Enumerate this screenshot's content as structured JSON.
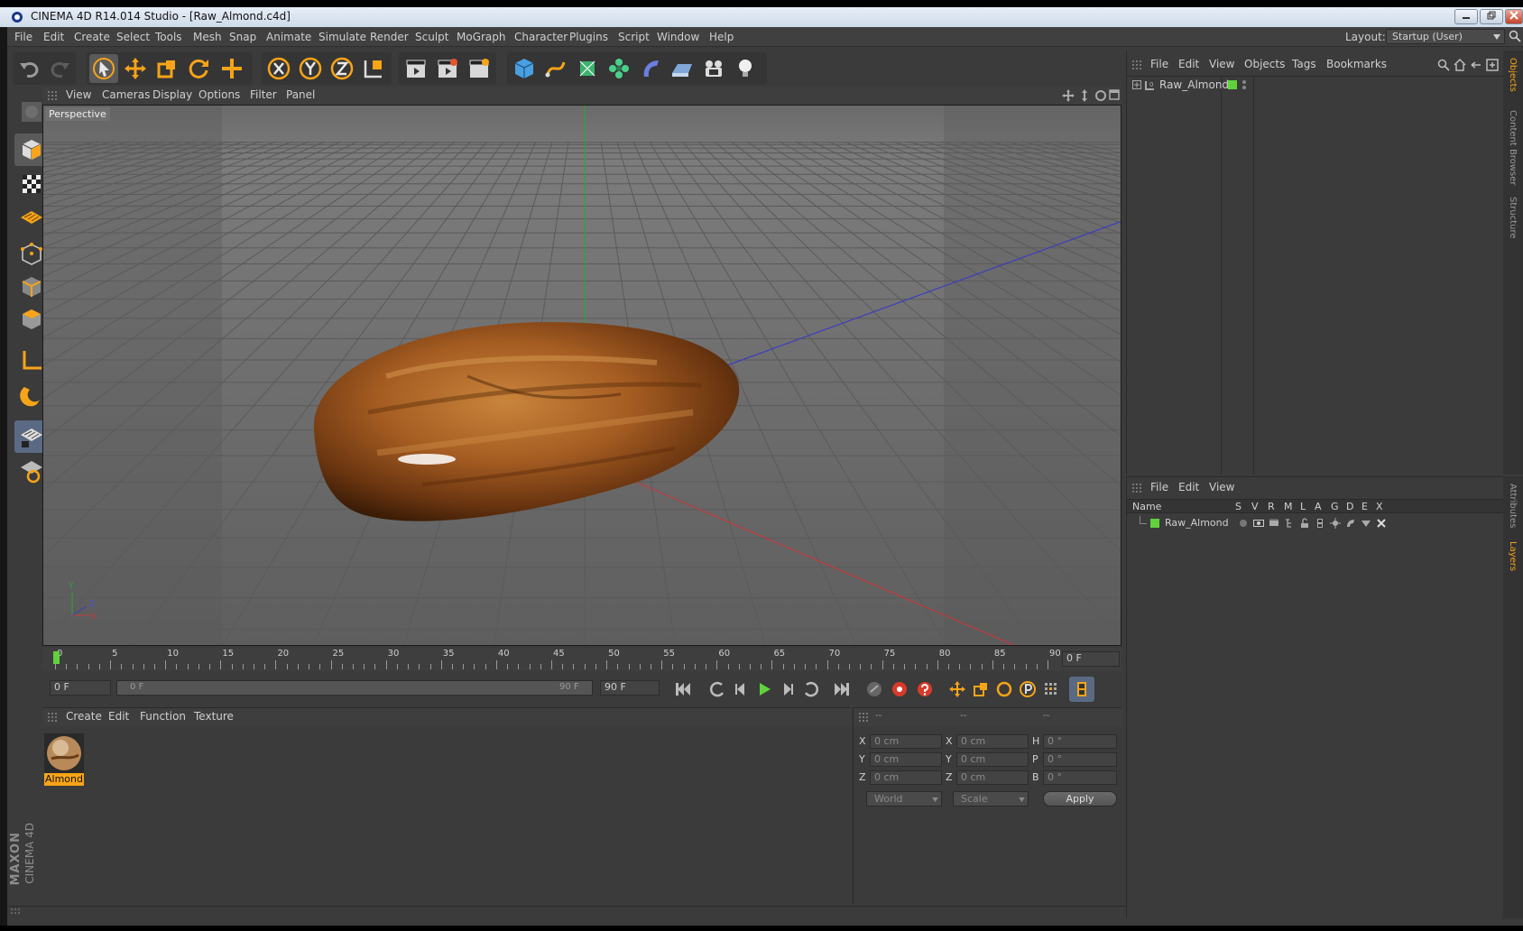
{
  "app": {
    "title": "CINEMA 4D R14.014 Studio - [Raw_Almond.c4d]",
    "window_controls": [
      "minimize-icon",
      "restore-icon",
      "close-icon"
    ]
  },
  "menubar": {
    "items": [
      "File",
      "Edit",
      "Create",
      "Select",
      "Tools",
      "Mesh",
      "Snap",
      "Animate",
      "Simulate",
      "Render",
      "Sculpt",
      "MoGraph",
      "Character",
      "Plugins",
      "Script",
      "Window",
      "Help"
    ],
    "layout_label": "Layout:",
    "layout_value": "Startup (User)"
  },
  "viewport": {
    "menu": [
      "View",
      "Cameras",
      "Display",
      "Options",
      "Filter",
      "Panel"
    ],
    "label": "Perspective",
    "axis_labels": {
      "y": "Y",
      "x": "X",
      "z": "Z"
    }
  },
  "timeline": {
    "ticks": [
      "0",
      "5",
      "10",
      "15",
      "20",
      "25",
      "30",
      "35",
      "40",
      "45",
      "50",
      "55",
      "60",
      "65",
      "70",
      "75",
      "80",
      "85",
      "90"
    ],
    "current_frame": "0 F",
    "start_field": "0 F",
    "range_start": "0 F",
    "range_end": "90 F",
    "end_field": "90 F",
    "playhead_fraction": 0.0
  },
  "material_manager": {
    "menu": [
      "Create",
      "Edit",
      "Function",
      "Texture"
    ],
    "materials": [
      {
        "name": "Almond"
      }
    ]
  },
  "coordinates": {
    "headers": [
      "--",
      "--",
      "--"
    ],
    "rows": [
      {
        "a_label": "X",
        "a_value": "0 cm",
        "b_label": "X",
        "b_value": "0 cm",
        "c_label": "H",
        "c_value": "0 °"
      },
      {
        "a_label": "Y",
        "a_value": "0 cm",
        "b_label": "Y",
        "b_value": "0 cm",
        "c_label": "P",
        "c_value": "0 °"
      },
      {
        "a_label": "Z",
        "a_value": "0 cm",
        "b_label": "Z",
        "b_value": "0 cm",
        "c_label": "B",
        "c_value": "0 °"
      }
    ],
    "space": "World",
    "mode": "Scale",
    "apply_label": "Apply"
  },
  "object_manager": {
    "menu": [
      "File",
      "Edit",
      "View",
      "Objects",
      "Tags",
      "Bookmarks"
    ],
    "objects": [
      {
        "name": "Raw_Almond"
      }
    ],
    "side_tabs": [
      "Objects",
      "Content Browser",
      "Structure"
    ]
  },
  "layer_manager": {
    "menu": [
      "File",
      "Edit",
      "View"
    ],
    "columns": [
      "Name",
      "S",
      "V",
      "R",
      "M",
      "L",
      "A",
      "G",
      "D",
      "E",
      "X"
    ],
    "rows": [
      {
        "name": "Raw_Almond"
      }
    ],
    "side_tabs": [
      "Attributes",
      "Layers"
    ]
  },
  "branding": {
    "maxon": "MAXON",
    "product": "CINEMA 4D"
  },
  "colors": {
    "accent": "#f7a418",
    "layer_green": "#5fd23c",
    "axis_x": "#c23b3b",
    "axis_y": "#2fa43a",
    "axis_z": "#3c3cc0"
  }
}
